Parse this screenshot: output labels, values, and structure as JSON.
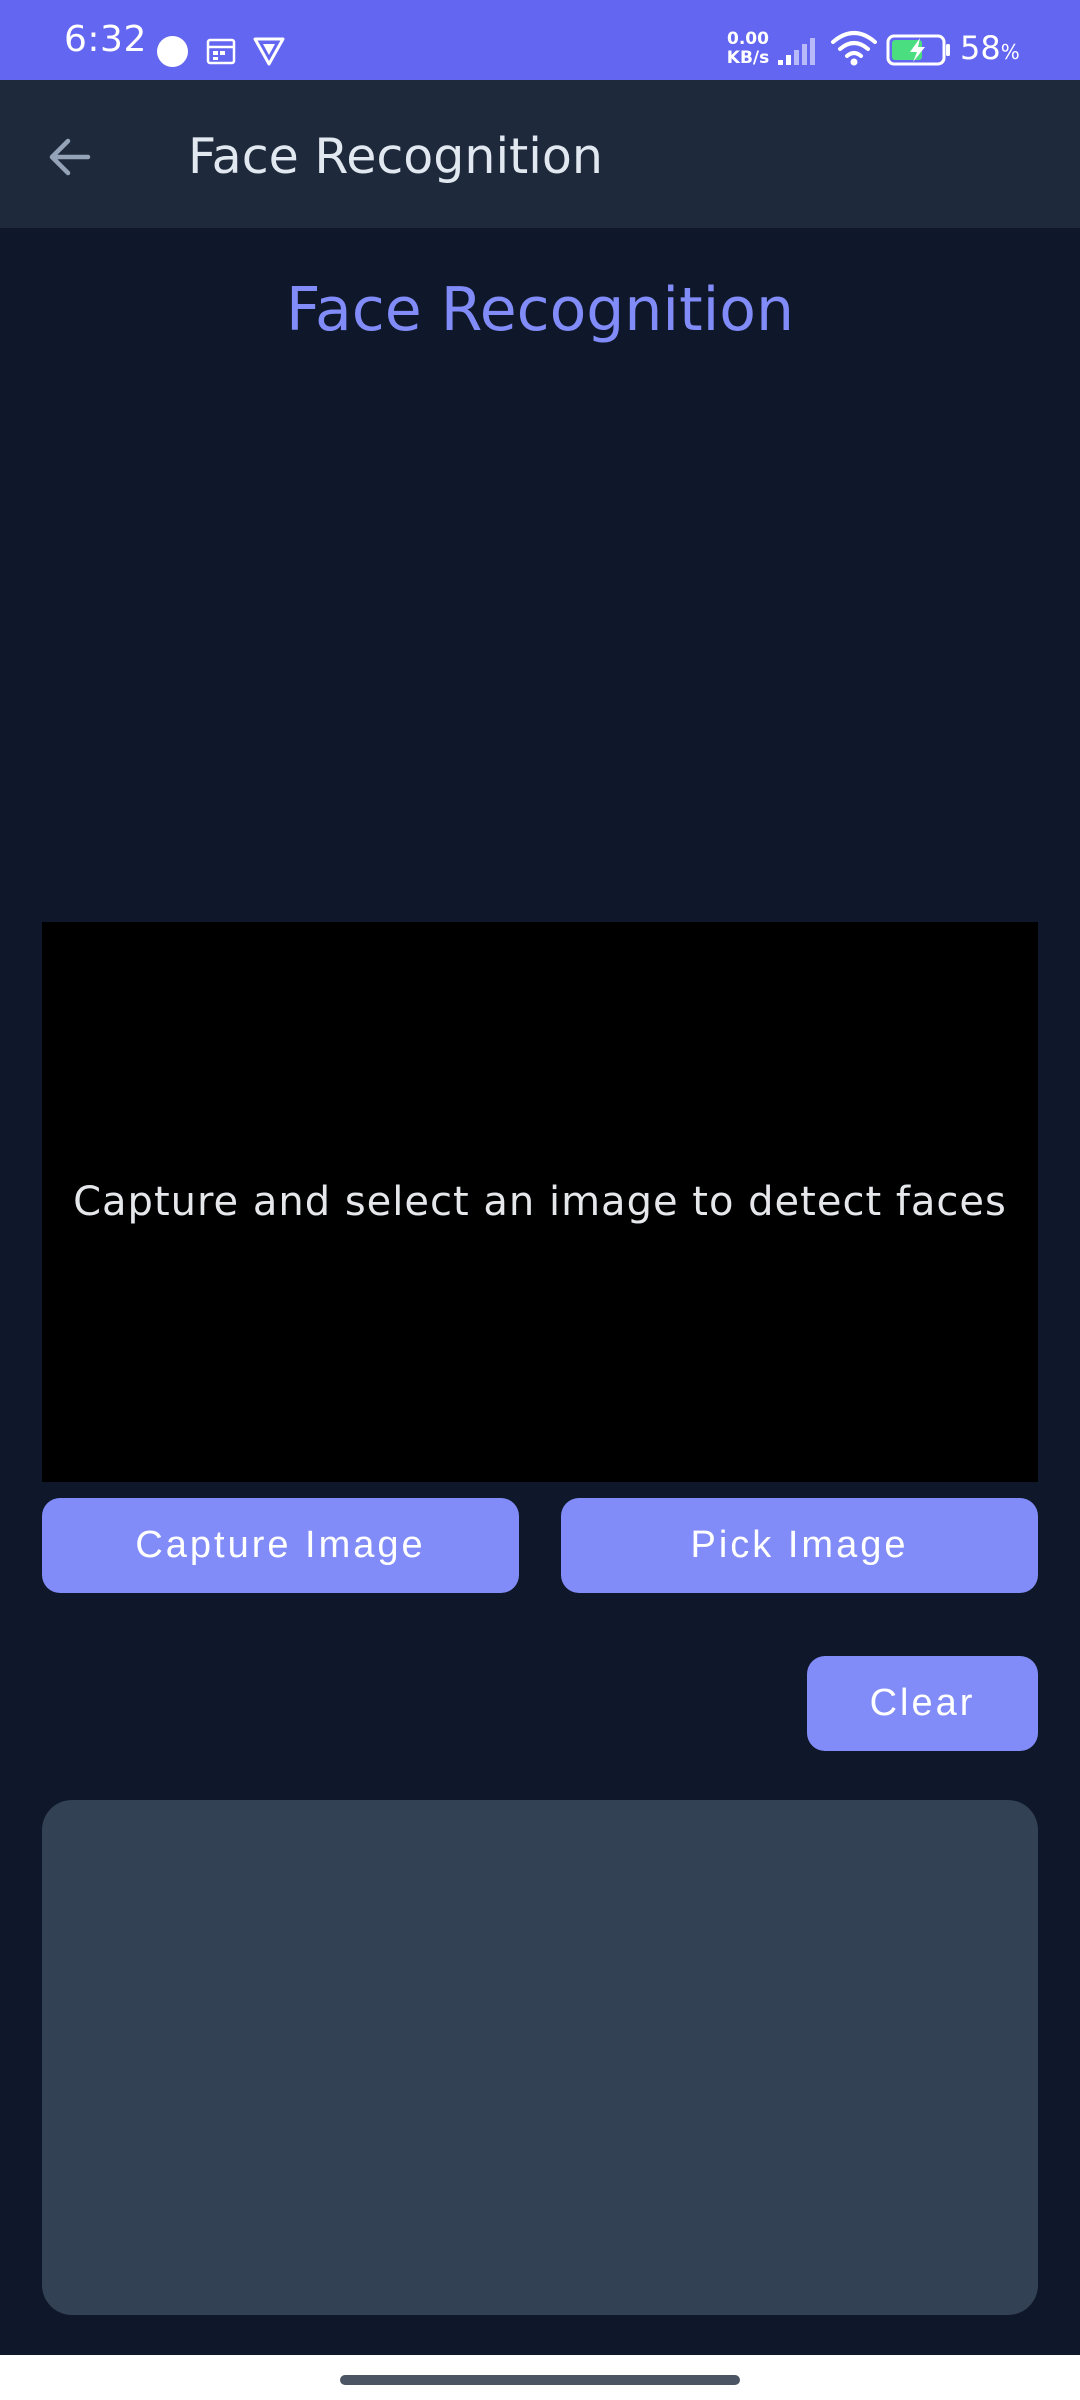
{
  "status_bar": {
    "time": "6:32",
    "net_speed_value": "0.00",
    "net_speed_unit": "KB/s",
    "battery_percent": "58",
    "battery_suffix": "%",
    "icons": [
      "circle-icon",
      "calendar-icon",
      "shield-icon",
      "signal-icon",
      "wifi-icon",
      "battery-charging-icon"
    ],
    "background_color": "#6366f1"
  },
  "app_bar": {
    "back_icon": "arrow-left-icon",
    "title": "Face Recognition",
    "background_color": "#1e293b"
  },
  "main": {
    "heading": "Face Recognition",
    "heading_color": "#818cf8",
    "preview": {
      "hint": "Capture and select an image to detect faces"
    },
    "buttons": {
      "capture_label": "Capture Image",
      "pick_label": "Pick Image",
      "clear_label": "Clear",
      "color": "#818cf8"
    },
    "results_panel_color": "#334155",
    "background_color": "#0f172a"
  }
}
